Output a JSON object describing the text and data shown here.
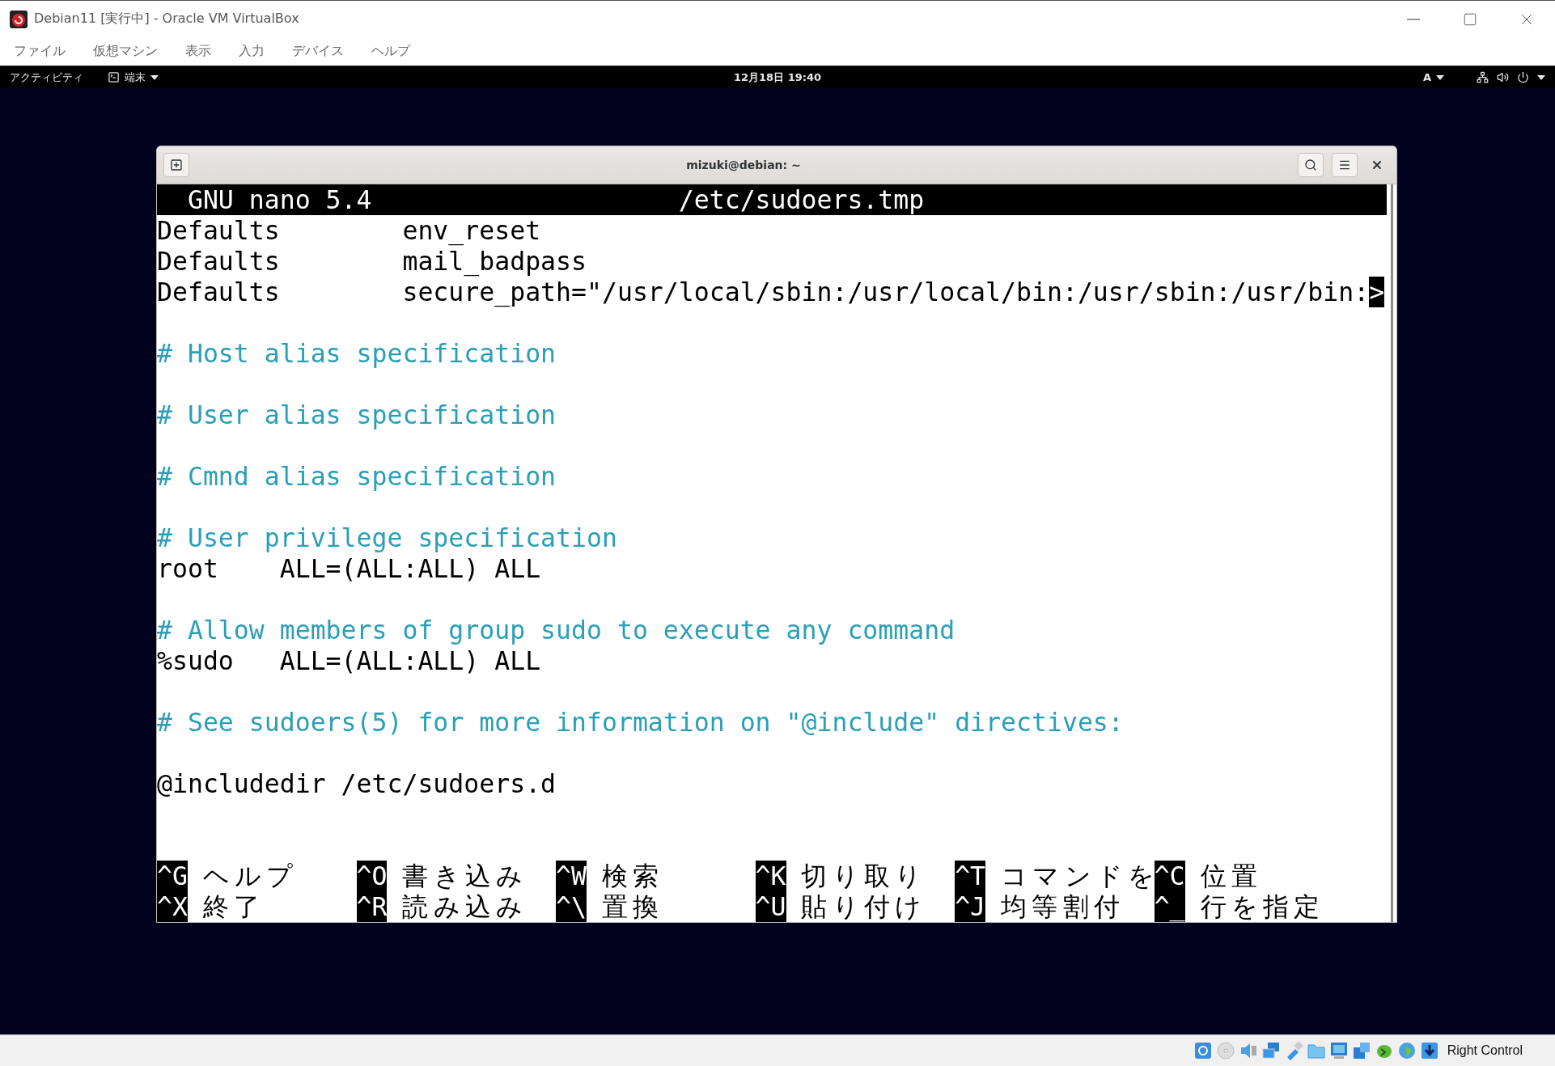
{
  "window": {
    "title": "Debian11 [実行中] - Oracle VM VirtualBox"
  },
  "menu": [
    "ファイル",
    "仮想マシン",
    "表示",
    "入力",
    "デバイス",
    "ヘルプ"
  ],
  "top_bar": {
    "activities": "アクティビティ",
    "app": "端末",
    "clock": "12月18日 19:40",
    "input_method": "A"
  },
  "terminal": {
    "title": "mizuki@debian: ~",
    "nano": {
      "version": "GNU nano 5.4",
      "file": "/etc/sudoers.tmp",
      "lines": [
        {
          "kind": "code",
          "text": "Defaults        env_reset"
        },
        {
          "kind": "code",
          "text": "Defaults        mail_badpass"
        },
        {
          "kind": "code",
          "text": "Defaults        secure_path=\"/usr/local/sbin:/usr/local/bin:/usr/sbin:/usr/bin:",
          "overflow_mark": ">"
        },
        {
          "kind": "blank"
        },
        {
          "kind": "comment",
          "text": "# Host alias specification"
        },
        {
          "kind": "blank"
        },
        {
          "kind": "comment",
          "text": "# User alias specification"
        },
        {
          "kind": "blank"
        },
        {
          "kind": "comment",
          "text": "# Cmnd alias specification"
        },
        {
          "kind": "blank"
        },
        {
          "kind": "comment",
          "text": "# User privilege specification"
        },
        {
          "kind": "code",
          "text": "root    ALL=(ALL:ALL) ALL"
        },
        {
          "kind": "blank"
        },
        {
          "kind": "comment",
          "text": "# Allow members of group sudo to execute any command"
        },
        {
          "kind": "code",
          "text": "%sudo   ALL=(ALL:ALL) ALL"
        },
        {
          "kind": "blank"
        },
        {
          "kind": "comment",
          "text": "# See sudoers(5) for more information on \"@include\" directives:"
        },
        {
          "kind": "blank"
        },
        {
          "kind": "code",
          "text": "@includedir /etc/sudoers.d"
        }
      ],
      "shortcuts": [
        {
          "key": "^G",
          "label": "ヘルプ"
        },
        {
          "key": "^O",
          "label": "書き込み"
        },
        {
          "key": "^W",
          "label": "検索"
        },
        {
          "key": "^K",
          "label": "切り取り"
        },
        {
          "key": "^T",
          "label": "コマンドを"
        },
        {
          "key": "^C",
          "label": "位置"
        },
        {
          "key": "^X",
          "label": "終了"
        },
        {
          "key": "^R",
          "label": "読み込み"
        },
        {
          "key": "^\\",
          "label": "置換"
        },
        {
          "key": "^U",
          "label": "貼り付け"
        },
        {
          "key": "^J",
          "label": "均等割付"
        },
        {
          "key": "^_",
          "label": "行を指定"
        }
      ]
    }
  },
  "status_bar": {
    "host_key": "Right Control"
  }
}
